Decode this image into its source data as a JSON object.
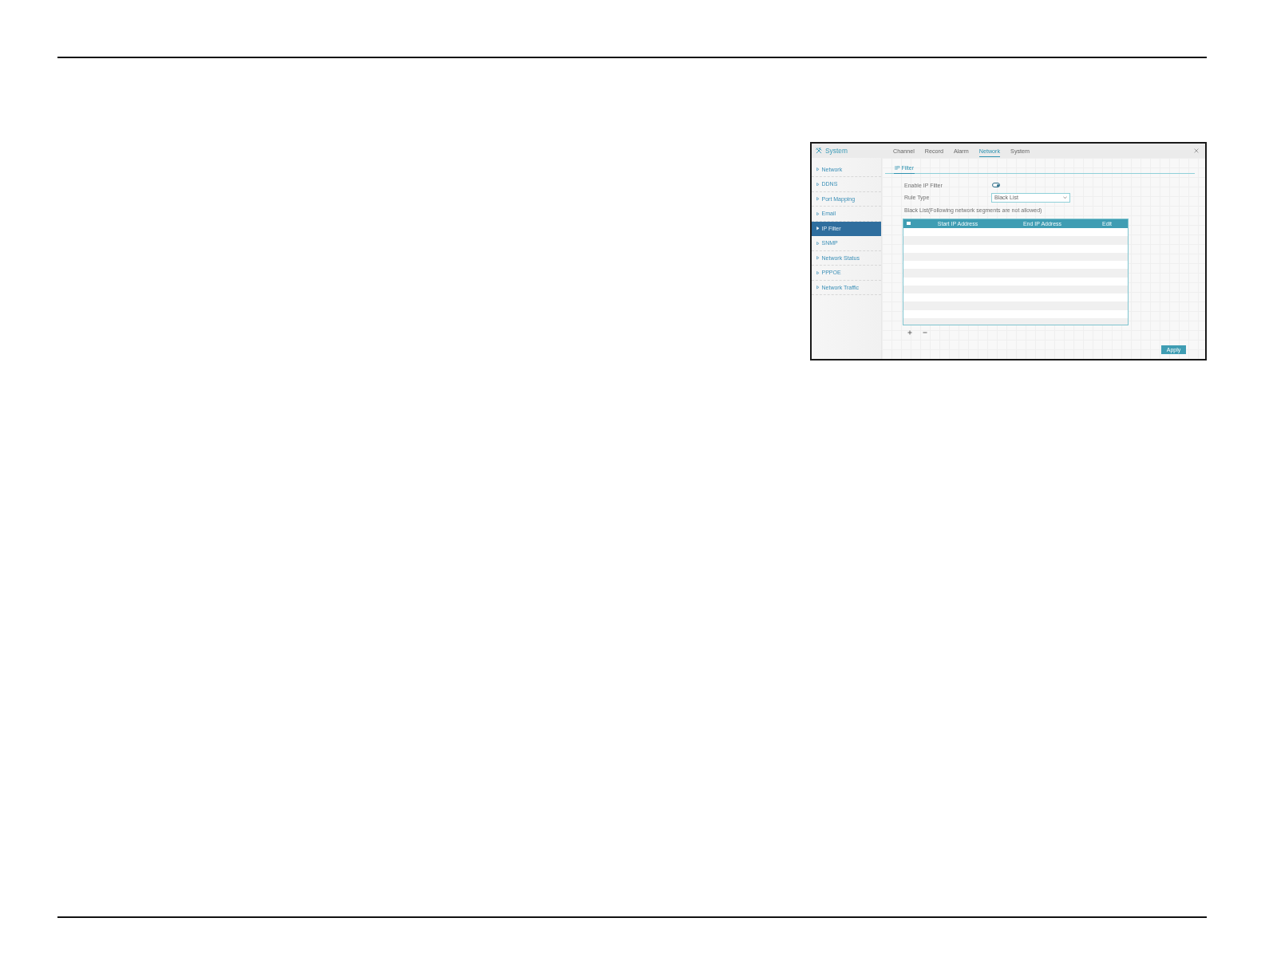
{
  "window": {
    "title": "System"
  },
  "tabs": [
    {
      "label": "Channel",
      "selected": false
    },
    {
      "label": "Record",
      "selected": false
    },
    {
      "label": "Alarm",
      "selected": false
    },
    {
      "label": "Network",
      "selected": true
    },
    {
      "label": "System",
      "selected": false
    }
  ],
  "sidebar": {
    "items": [
      {
        "label": "Network",
        "selected": false
      },
      {
        "label": "DDNS",
        "selected": false
      },
      {
        "label": "Port Mapping",
        "selected": false
      },
      {
        "label": "Email",
        "selected": false
      },
      {
        "label": "IP Filter",
        "selected": true
      },
      {
        "label": "SNMP",
        "selected": false
      },
      {
        "label": "Network Status",
        "selected": false
      },
      {
        "label": "PPPOE",
        "selected": false
      },
      {
        "label": "Network Traffic",
        "selected": false
      }
    ]
  },
  "section_tab": {
    "label": "IP Filter",
    "selected": true
  },
  "form": {
    "enable_ip_filter": {
      "label": "Enable IP Filter",
      "on": true
    },
    "rule_type": {
      "label": "Rule Type",
      "value": "Black List"
    },
    "note": "Black List(Following network segments are not allowed)"
  },
  "table": {
    "select_all": {
      "checked": false
    },
    "columns": [
      "Start IP Address",
      "End IP Address",
      "Edit"
    ]
  },
  "buttons": {
    "apply": "Apply"
  }
}
